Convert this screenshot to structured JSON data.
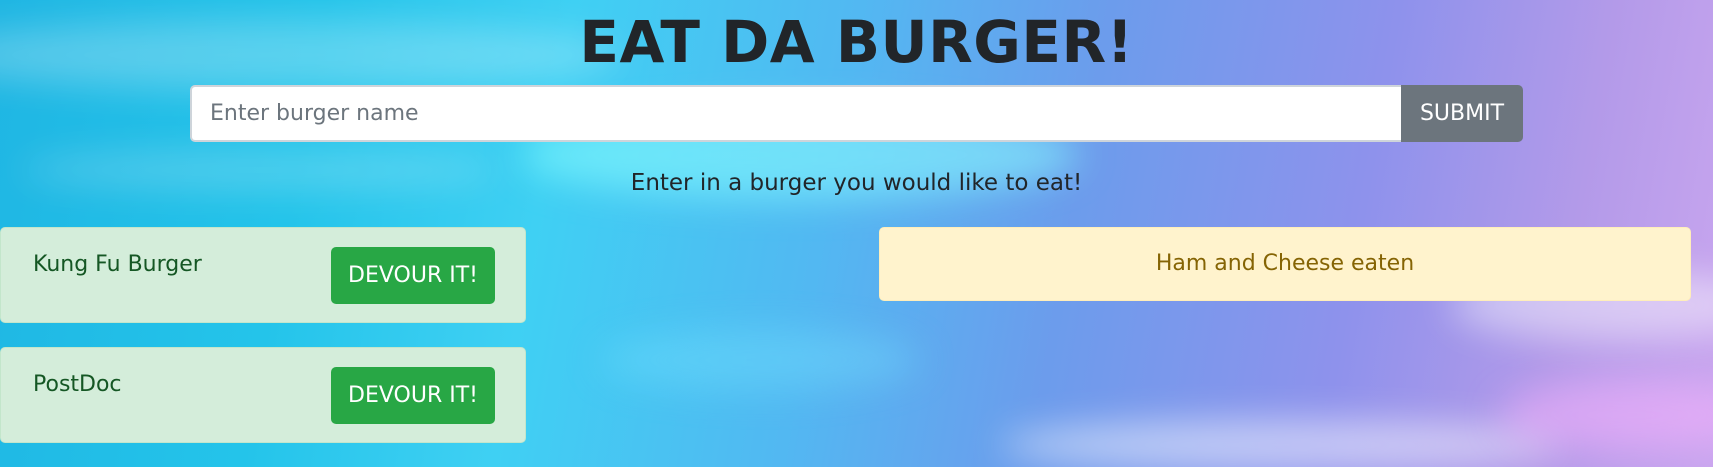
{
  "header": {
    "title": "EAT DA BURGER!"
  },
  "form": {
    "input_value": "",
    "input_placeholder": "Enter burger name",
    "submit_label": "SUBMIT",
    "helper_text": "Enter in a burger you would like to eat!"
  },
  "uneaten": [
    {
      "name": "Kung Fu Burger",
      "button_label": "DEVOUR IT!"
    },
    {
      "name": "PostDoc",
      "button_label": "DEVOUR IT!"
    }
  ],
  "eaten": [
    {
      "label": "Ham and Cheese eaten"
    }
  ],
  "colors": {
    "uneaten_card": "#d4edda",
    "devour_button": "#28a745",
    "submit_button": "#6c757d",
    "eaten_card": "#fff3cd",
    "eaten_text": "#856404"
  }
}
